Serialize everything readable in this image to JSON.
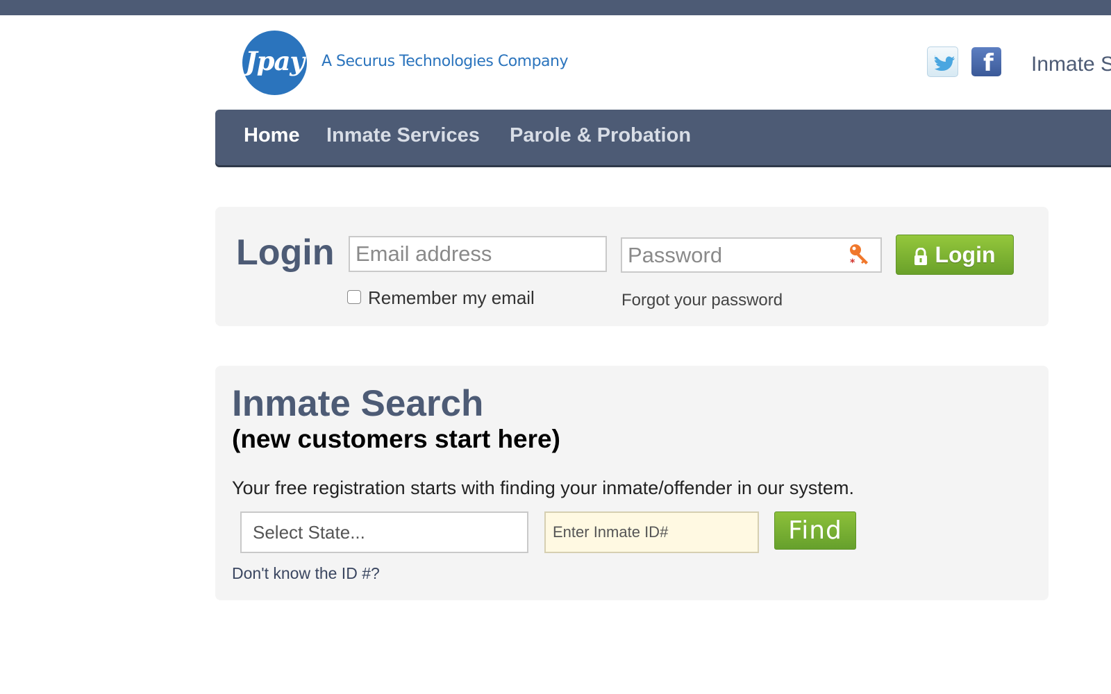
{
  "header": {
    "logo_text": "Jpay",
    "tagline": "A Securus Technologies Company",
    "right_text": "Inmate S",
    "social": [
      "twitter-icon",
      "facebook-icon"
    ]
  },
  "nav": {
    "items": [
      {
        "label": "Home",
        "active": true
      },
      {
        "label": "Inmate Services",
        "active": false
      },
      {
        "label": "Parole & Probation",
        "active": false
      }
    ]
  },
  "login": {
    "title": "Login",
    "email_placeholder": "Email address",
    "password_placeholder": "Password",
    "button_label": "Login",
    "remember_label": "Remember my email",
    "remember_checked": false,
    "forgot_label": "Forgot your password"
  },
  "search": {
    "title": "Inmate Search",
    "subtitle": "(new customers start here)",
    "description": "Your free registration starts with finding your inmate/offender in our system.",
    "state_placeholder": "Select State...",
    "id_placeholder": "Enter Inmate ID#",
    "find_label": "Find",
    "dont_know_label": "Don't know the ID #?"
  },
  "colors": {
    "nav_bg": "#4d5b75",
    "brand_blue": "#2b74bd",
    "button_green": "#7ab434",
    "panel_bg": "#f4f4f4"
  }
}
